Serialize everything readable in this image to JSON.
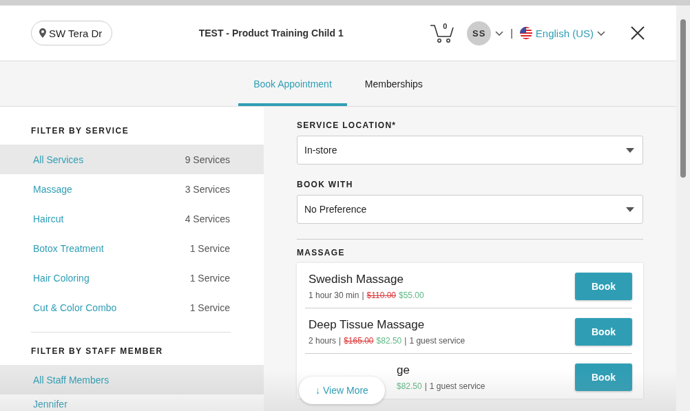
{
  "header": {
    "location": "SW Tera Dr",
    "title": "TEST - Product Training Child 1",
    "cart_count": "0",
    "avatar": "SS",
    "separator": "|",
    "language": "English (US)"
  },
  "tabs": [
    {
      "label": "Book Appointment",
      "selected": true
    },
    {
      "label": "Memberships",
      "selected": false
    }
  ],
  "service_filter": {
    "heading": "FILTER BY SERVICE",
    "items": [
      {
        "label": "All Services",
        "count": "9 Services",
        "selected": true
      },
      {
        "label": "Massage",
        "count": "3 Services",
        "selected": false
      },
      {
        "label": "Haircut",
        "count": "4 Services",
        "selected": false
      },
      {
        "label": "Botox Treatment",
        "count": "1 Service",
        "selected": false
      },
      {
        "label": "Hair Coloring",
        "count": "1 Service",
        "selected": false
      },
      {
        "label": "Cut & Color Combo",
        "count": "1 Service",
        "selected": false
      }
    ]
  },
  "staff_filter": {
    "heading": "FILTER BY STAFF MEMBER",
    "items": [
      {
        "label": "All Staff Members",
        "selected": true
      },
      {
        "label": "Jennifer",
        "selected": false
      }
    ]
  },
  "service_location": {
    "label": "SERVICE LOCATION*",
    "value": "In-store"
  },
  "book_with": {
    "label": "BOOK WITH",
    "value": "No Preference"
  },
  "section": {
    "heading": "MASSAGE",
    "services": [
      {
        "kind": "full",
        "name": "Swedish Massage",
        "details": [
          {
            "kind": "plain",
            "text": "1 hour 30 min"
          },
          {
            "kind": "sep",
            "text": "|"
          },
          {
            "kind": "old",
            "text": "$110.00"
          },
          {
            "kind": "new",
            "text": "$55.00"
          }
        ],
        "button": "Book"
      },
      {
        "kind": "full",
        "name": "Deep Tissue Massage",
        "details": [
          {
            "kind": "plain",
            "text": "2 hours"
          },
          {
            "kind": "sep",
            "text": "|"
          },
          {
            "kind": "old",
            "text": "$165.00"
          },
          {
            "kind": "new",
            "text": "$82.50"
          },
          {
            "kind": "sep",
            "text": "|"
          },
          {
            "kind": "plain",
            "text": "1 guest service"
          }
        ],
        "button": "Book"
      },
      {
        "kind": "partial",
        "name": "ge",
        "details": [
          {
            "kind": "new",
            "text": "$82.50"
          },
          {
            "kind": "sep",
            "text": "|"
          },
          {
            "kind": "plain",
            "text": "1 guest service"
          }
        ],
        "button": "Book"
      }
    ]
  },
  "view_more": "↓ View More"
}
